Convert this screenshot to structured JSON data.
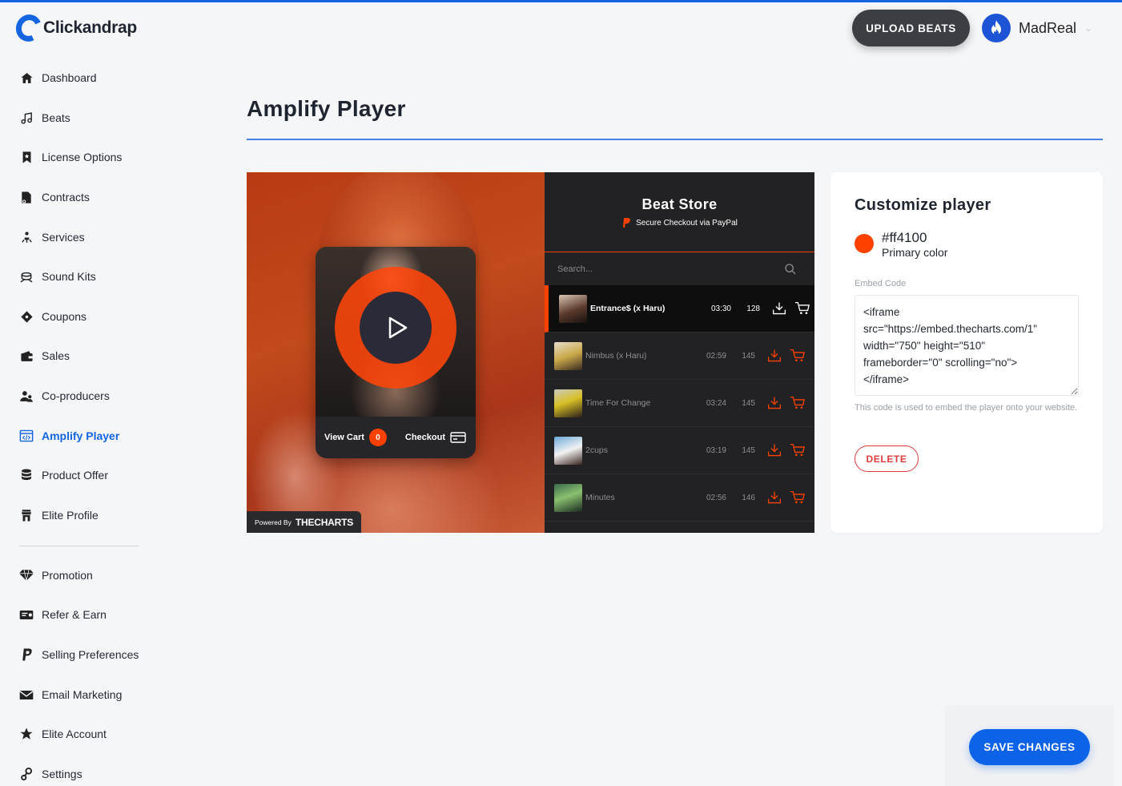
{
  "app": {
    "name": "Clickandrap"
  },
  "header": {
    "upload_label": "UPLOAD BEATS",
    "username": "MadReal"
  },
  "sidebar": {
    "items": [
      {
        "label": "Dashboard",
        "icon": "home-icon"
      },
      {
        "label": "Beats",
        "icon": "music-note-icon"
      },
      {
        "label": "License Options",
        "icon": "bookmark-icon"
      },
      {
        "label": "Contracts",
        "icon": "contract-icon"
      },
      {
        "label": "Services",
        "icon": "services-icon"
      },
      {
        "label": "Sound Kits",
        "icon": "sound-kits-icon"
      },
      {
        "label": "Coupons",
        "icon": "coupon-icon"
      },
      {
        "label": "Sales",
        "icon": "wallet-icon"
      },
      {
        "label": "Co-producers",
        "icon": "users-icon"
      },
      {
        "label": "Amplify Player",
        "icon": "embed-icon",
        "active": true
      },
      {
        "label": "Product Offer",
        "icon": "database-icon"
      },
      {
        "label": "Elite Profile",
        "icon": "store-icon"
      },
      {
        "label": "Promotion",
        "icon": "diamond-icon"
      },
      {
        "label": "Refer & Earn",
        "icon": "ticket-icon"
      },
      {
        "label": "Selling Preferences",
        "icon": "paypal-icon"
      },
      {
        "label": "Email Marketing",
        "icon": "mail-icon"
      },
      {
        "label": "Elite Account",
        "icon": "star-icon"
      },
      {
        "label": "Settings",
        "icon": "settings-icon"
      }
    ]
  },
  "page": {
    "title": "Amplify Player"
  },
  "player": {
    "cart_label": "View Cart",
    "cart_count": "0",
    "checkout_label": "Checkout",
    "powered_by": "Powered By",
    "powered_brand": "THECHARTS",
    "store_title": "Beat Store",
    "store_subtitle": "Secure Checkout via PayPal",
    "search_placeholder": "Search...",
    "tracks": [
      {
        "name": "Entrance$ (x Haru)",
        "duration": "03:30",
        "bpm": "128",
        "active": true
      },
      {
        "name": "Nimbus (x Haru)",
        "duration": "02:59",
        "bpm": "145"
      },
      {
        "name": "Time For Change",
        "duration": "03:24",
        "bpm": "145"
      },
      {
        "name": "2cups",
        "duration": "03:19",
        "bpm": "145"
      },
      {
        "name": "Minutes",
        "duration": "02:56",
        "bpm": "146"
      }
    ],
    "primary_color": "#ff4100"
  },
  "customize": {
    "title": "Customize player",
    "color_hex": "#ff4100",
    "color_label": "Primary color",
    "embed_label": "Embed Code",
    "embed_code": "<iframe\nsrc=\"https://embed.thecharts.com/1\"\nwidth=\"750\" height=\"510\"\nframeborder=\"0\" scrolling=\"no\">\n</iframe>",
    "help_text": "This code is used to embed the player onto your website.",
    "delete_label": "DELETE"
  },
  "footer": {
    "save_label": "SAVE CHANGES"
  },
  "colors": {
    "accent": "#1565e0",
    "player_primary": "#ff4100",
    "danger": "#e03a3a"
  }
}
